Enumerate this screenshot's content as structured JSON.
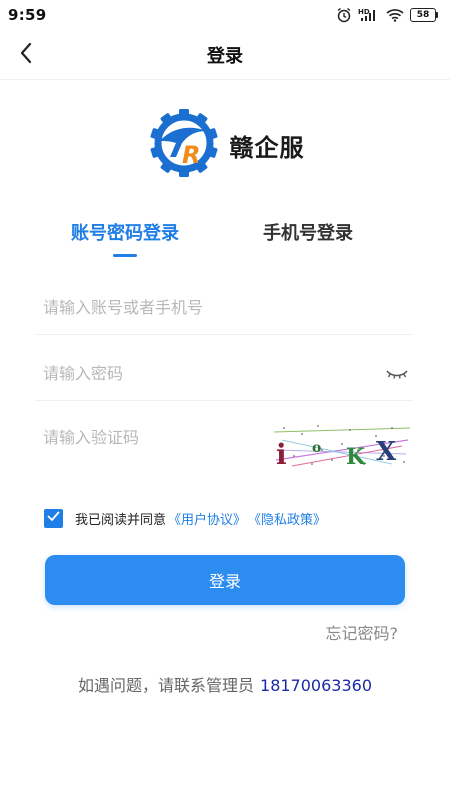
{
  "status_bar": {
    "time": "9:59",
    "battery": "58",
    "icons": [
      "alarm-icon",
      "hd-signal-icon",
      "wifi-icon",
      "battery-icon"
    ]
  },
  "nav": {
    "title": "登录",
    "back_icon": "chevron-left-icon"
  },
  "brand": {
    "name": "赣企服",
    "logo_icon": "gear-bird-logo",
    "colors": {
      "gear": "#1b6fd1",
      "letter_r": "#f08c1a"
    }
  },
  "tabs": [
    {
      "label": "账号密码登录",
      "active": true
    },
    {
      "label": "手机号登录",
      "active": false
    }
  ],
  "form": {
    "account_placeholder": "请输入账号或者手机号",
    "account_value": "",
    "password_placeholder": "请输入密码",
    "password_value": "",
    "captcha_placeholder": "请输入验证码",
    "captcha_value": "",
    "captcha_text": "iOKX",
    "password_toggle_icon": "eye-closed-icon"
  },
  "agreement": {
    "checked": true,
    "text": "我已阅读并同意",
    "user_agreement": "《用户协议》",
    "privacy_policy": "《隐私政策》"
  },
  "login_button": "登录",
  "forgot_password": "忘记密码?",
  "contact": {
    "text": "如遇问题，请联系管理员",
    "phone": "18170063360"
  },
  "colors": {
    "accent": "#1f7fe6",
    "button": "#2d8cf0",
    "phone_link": "#1a2aa8"
  }
}
